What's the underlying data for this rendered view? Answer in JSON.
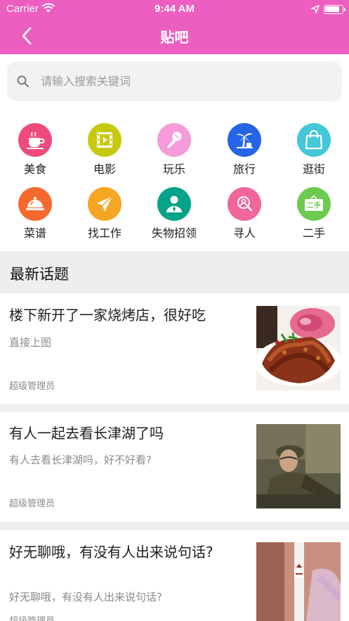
{
  "status_bar": {
    "carrier": "Carrier",
    "time": "9:44 AM"
  },
  "nav": {
    "title": "贴吧",
    "back_icon": "chevron-left-icon"
  },
  "search": {
    "placeholder": "请输入搜索关键词",
    "icon": "search-icon"
  },
  "categories": [
    {
      "label": "美食",
      "icon": "coffee-cup-icon",
      "color": "#ee4b7b"
    },
    {
      "label": "电影",
      "icon": "film-icon",
      "color": "#c8c90e"
    },
    {
      "label": "玩乐",
      "icon": "microphone-icon",
      "color": "#f69bd9"
    },
    {
      "label": "旅行",
      "icon": "palm-tree-icon",
      "color": "#2464e7"
    },
    {
      "label": "逛街",
      "icon": "shopping-bag-icon",
      "color": "#44c7d8"
    },
    {
      "label": "菜谱",
      "icon": "food-cloche-icon",
      "color": "#f56a2c"
    },
    {
      "label": "找工作",
      "icon": "paper-plane-icon",
      "color": "#f5a623"
    },
    {
      "label": "失物招领",
      "icon": "person-icon",
      "color": "#05a38a"
    },
    {
      "label": "寻人",
      "icon": "search-person-icon",
      "color": "#f1669b"
    },
    {
      "label": "二手",
      "icon": "secondhand-sign-icon",
      "color": "#6ccb4e"
    }
  ],
  "second_hand_sign_text": "二手",
  "section": {
    "title": "最新话题"
  },
  "posts": [
    {
      "title": "楼下新开了一家烧烤店，很好吃",
      "desc": "直接上图",
      "author": "超级管理员",
      "image": "barbecue-skewers-photo"
    },
    {
      "title": "有人一起去看长津湖了吗",
      "desc": "有人去看长津湖吗，好不好看?",
      "author": "超级管理员",
      "image": "soldier-movie-still-photo"
    },
    {
      "title": "好无聊哦，有没有人出来说句话?",
      "desc": "好无聊哦，有没有人出来说句话?",
      "author": "超级管理员",
      "image": "cigarette-photo"
    }
  ],
  "colors": {
    "header": "#ec5ebf",
    "background": "#ffffff",
    "divider": "#eeeeee"
  }
}
